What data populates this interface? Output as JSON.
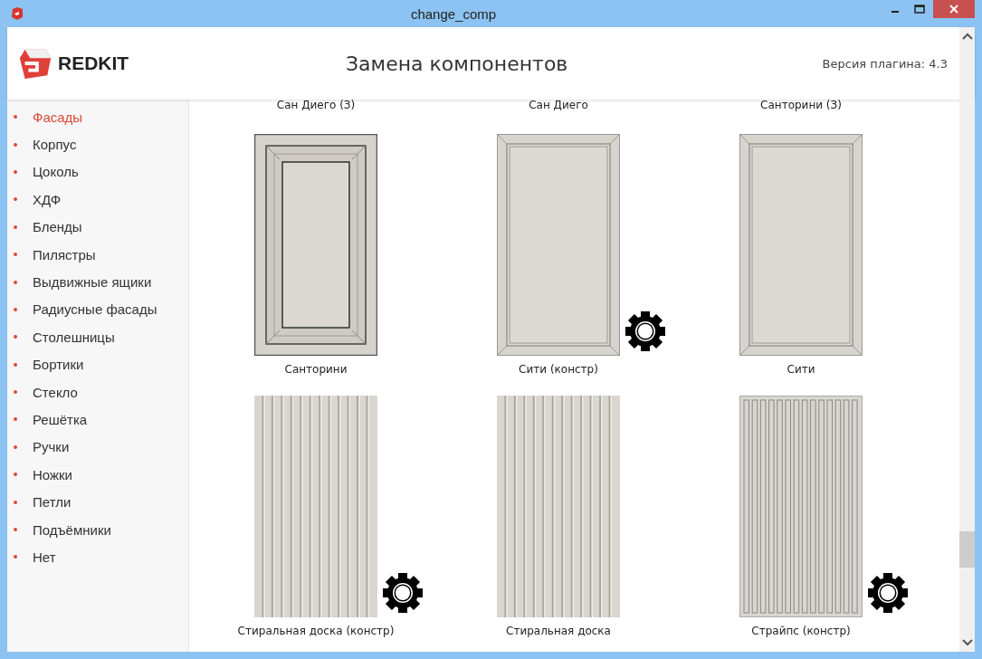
{
  "window": {
    "title": "change_comp"
  },
  "header": {
    "brand": "REDKIT",
    "title": "Замена компонентов",
    "version": "Версия плагина: 4.3"
  },
  "sidebar": {
    "items": [
      {
        "label": "Фасады",
        "selected": true
      },
      {
        "label": "Корпус",
        "selected": false
      },
      {
        "label": "Цоколь",
        "selected": false
      },
      {
        "label": "ХДФ",
        "selected": false
      },
      {
        "label": "Бленды",
        "selected": false
      },
      {
        "label": "Пилястры",
        "selected": false
      },
      {
        "label": "Выдвижные ящики",
        "selected": false
      },
      {
        "label": "Радиусные фасады",
        "selected": false
      },
      {
        "label": "Столешницы",
        "selected": false
      },
      {
        "label": "Бортики",
        "selected": false
      },
      {
        "label": "Стекло",
        "selected": false
      },
      {
        "label": "Решётка",
        "selected": false
      },
      {
        "label": "Ручки",
        "selected": false
      },
      {
        "label": "Ножки",
        "selected": false
      },
      {
        "label": "Петли",
        "selected": false
      },
      {
        "label": "Подъёмники",
        "selected": false
      },
      {
        "label": "Нет",
        "selected": false
      }
    ]
  },
  "components": [
    {
      "label": "Сан Диего (З)",
      "kind": "hidden"
    },
    {
      "label": "Сан Диего",
      "kind": "hidden"
    },
    {
      "label": "Санторини (З)",
      "kind": "hidden"
    },
    {
      "label": "Санторини",
      "kind": "raised",
      "configurable": false
    },
    {
      "label": "Сити (констр)",
      "kind": "frame",
      "configurable": true
    },
    {
      "label": "Сити",
      "kind": "frame",
      "configurable": false
    },
    {
      "label": "Стиральная доска (констр)",
      "kind": "washboard",
      "configurable": true
    },
    {
      "label": "Стиральная доска",
      "kind": "washboard",
      "configurable": false
    },
    {
      "label": "Страйпс (констр)",
      "kind": "stripes",
      "configurable": true
    }
  ]
}
